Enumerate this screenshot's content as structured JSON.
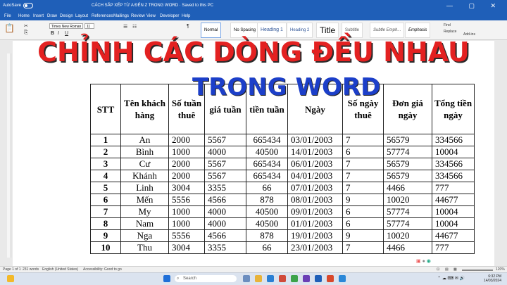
{
  "titlebar": {
    "autosave": "AutoSave",
    "document": "CÁCH SẮP XẾP TỪ A ĐẾN Z TRONG WORD · Saved to this PC",
    "window_controls": "— ▢ ✕"
  },
  "tabs": [
    "File",
    "Home",
    "Insert",
    "Draw",
    "Design",
    "Layout",
    "References",
    "Mailings",
    "Review",
    "View",
    "Developer",
    "Help"
  ],
  "ribbon": {
    "font_name": "Times New Roman",
    "font_size": "11",
    "styles": [
      "Normal",
      "No Spacing",
      "Heading 1",
      "Heading 2",
      "Title",
      "Subtitle",
      "Subtle Emph...",
      "Emphasis"
    ],
    "find": "Find",
    "replace": "Replace",
    "add_ins": "Add-ins"
  },
  "banner": {
    "line1": "CHỈNH CÁC DÒNG ĐỀU NHAU",
    "line2": "TRONG WORD"
  },
  "table": {
    "headers": [
      "STT",
      "Tên khách hàng",
      "Số tuần thuê",
      "giá tuần",
      "tiền tuần",
      "Ngày",
      "Số ngày thuê",
      "Đơn giá ngày",
      "Tổng tiền ngày"
    ],
    "rows": [
      [
        "1",
        "An",
        "2000",
        "5567",
        "665434",
        "03/01/2003",
        "7",
        "56579",
        "334566"
      ],
      [
        "2",
        "Bình",
        "1000",
        "4000",
        "40500",
        "14/01/2003",
        "6",
        "57774",
        "10004"
      ],
      [
        "3",
        "Cư",
        "2000",
        "5567",
        "665434",
        "06/01/2003",
        "7",
        "56579",
        "334566"
      ],
      [
        "4",
        "Khánh",
        "2000",
        "5567",
        "665434",
        "04/01/2003",
        "7",
        "56579",
        "334566"
      ],
      [
        "5",
        "Linh",
        "3004",
        "3355",
        "66",
        "07/01/2003",
        "7",
        "4466",
        "777"
      ],
      [
        "6",
        "Mến",
        "5556",
        "4566",
        "878",
        "08/01/2003",
        "9",
        "10020",
        "44677"
      ],
      [
        "7",
        "My",
        "1000",
        "4000",
        "40500",
        "09/01/2003",
        "6",
        "57774",
        "10004"
      ],
      [
        "8",
        "Nam",
        "1000",
        "4000",
        "40500",
        "01/01/2003",
        "6",
        "57774",
        "10004"
      ],
      [
        "9",
        "Nga",
        "5556",
        "4566",
        "878",
        "19/01/2003",
        "9",
        "10020",
        "44677"
      ],
      [
        "10",
        "Thu",
        "3004",
        "3355",
        "66",
        "23/01/2003",
        "7",
        "4466",
        "777"
      ]
    ]
  },
  "status": {
    "page": "Page 1 of 1",
    "words": "231 words",
    "language": "English (United States)",
    "accessibility": "Accessibility: Good to go",
    "zoom": "120%"
  },
  "taskbar": {
    "search": "Search",
    "time": "6:32 PM",
    "date": "14/03/2024"
  },
  "colors": {
    "banner_red": "#e32121",
    "banner_blue": "#1c3fc9",
    "word_blue": "#1f5fb8"
  }
}
